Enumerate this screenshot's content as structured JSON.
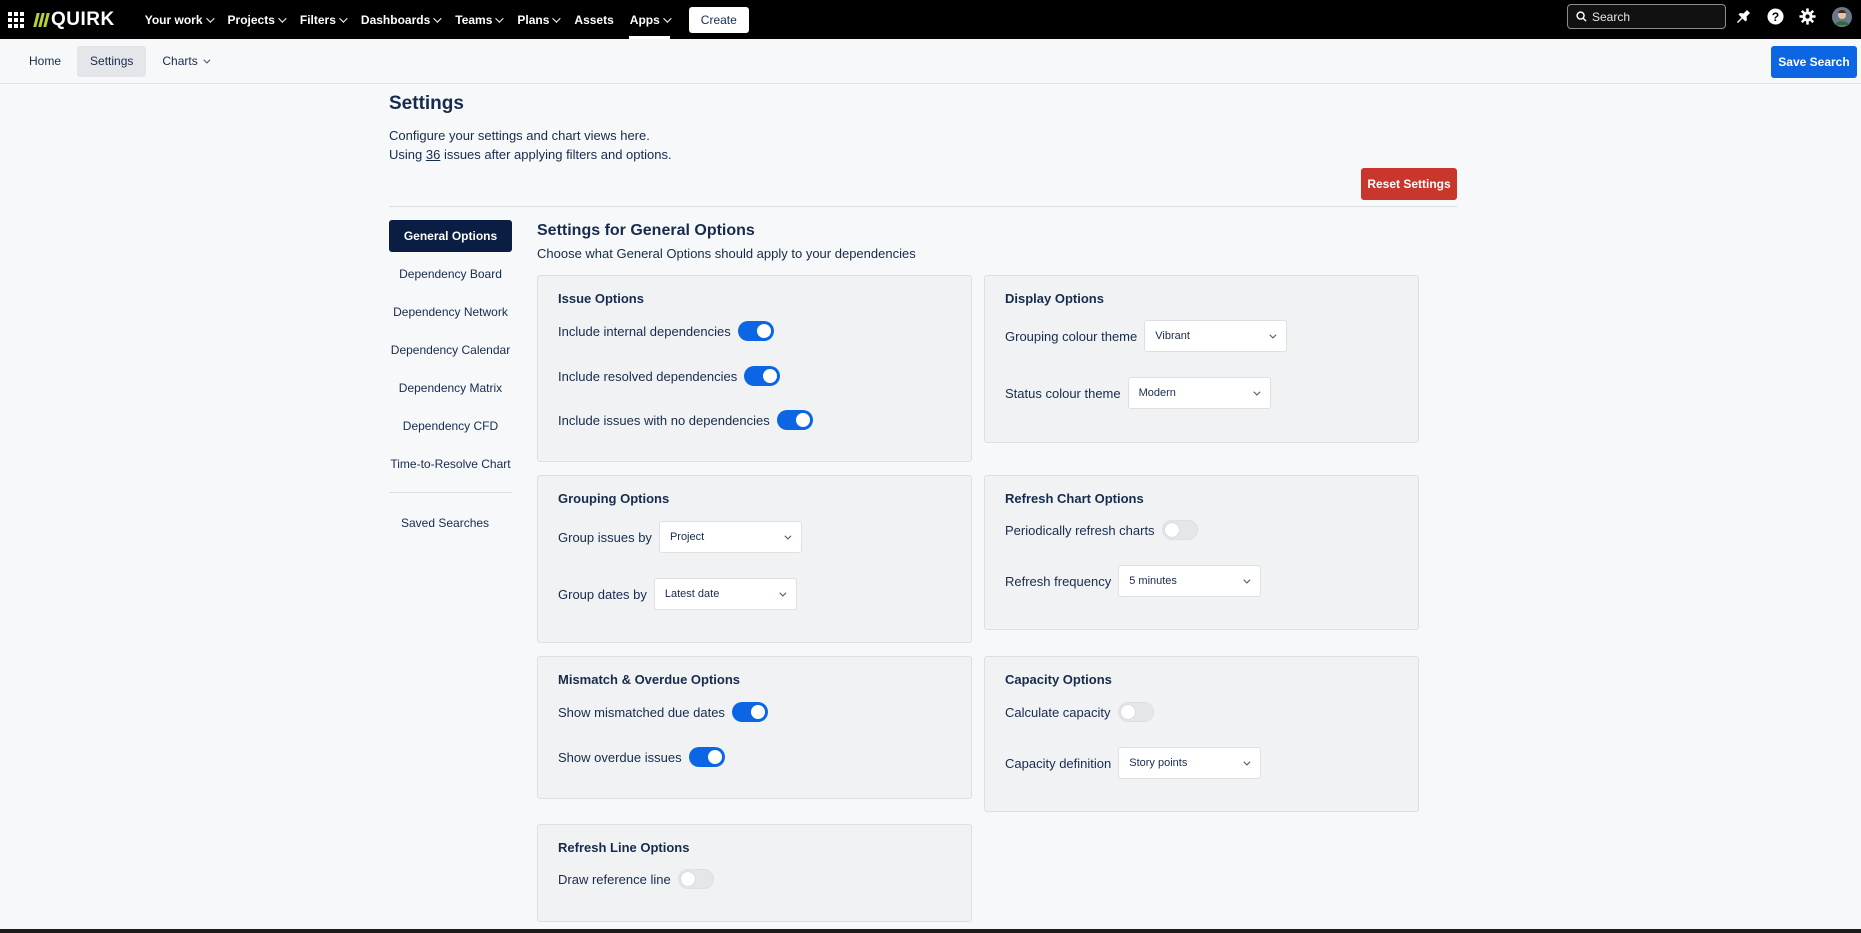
{
  "topnav": {
    "logo": "QUIRK",
    "items": [
      {
        "label": "Your work",
        "dropdown": true
      },
      {
        "label": "Projects",
        "dropdown": true
      },
      {
        "label": "Filters",
        "dropdown": true
      },
      {
        "label": "Dashboards",
        "dropdown": true
      },
      {
        "label": "Teams",
        "dropdown": true
      },
      {
        "label": "Plans",
        "dropdown": true
      },
      {
        "label": "Assets",
        "dropdown": false
      },
      {
        "label": "Apps",
        "dropdown": true,
        "active": true
      }
    ],
    "create_label": "Create",
    "search_placeholder": "Search",
    "icons": [
      "notifications-icon",
      "help-icon",
      "settings-gear-icon",
      "user-avatar"
    ]
  },
  "subbar": {
    "tabs": [
      {
        "label": "Home",
        "active": false,
        "dropdown": false
      },
      {
        "label": "Settings",
        "active": true,
        "dropdown": false
      },
      {
        "label": "Charts",
        "active": false,
        "dropdown": true
      }
    ],
    "save_search_label": "Save Search"
  },
  "page": {
    "title": "Settings",
    "desc_line1": "Configure your settings and chart views here.",
    "desc_line2_prefix": "Using ",
    "issue_count": "36",
    "desc_line2_suffix": " issues after applying filters and options.",
    "reset_label": "Reset Settings"
  },
  "side_menu": {
    "items": [
      {
        "label": "General Options",
        "active": true
      },
      {
        "label": "Dependency Board",
        "active": false
      },
      {
        "label": "Dependency Network",
        "active": false
      },
      {
        "label": "Dependency Calendar",
        "active": false
      },
      {
        "label": "Dependency Matrix",
        "active": false
      },
      {
        "label": "Dependency CFD",
        "active": false
      },
      {
        "label": "Time-to-Resolve Chart",
        "active": false
      }
    ],
    "saved_searches": "Saved Searches"
  },
  "content": {
    "title": "Settings for General Options",
    "desc": "Choose what General Options should apply to your dependencies"
  },
  "cards": {
    "issue": {
      "title": "Issue Options",
      "internal": {
        "label": "Include internal dependencies",
        "on": true
      },
      "resolved": {
        "label": "Include resolved dependencies",
        "on": true
      },
      "nodeps": {
        "label": "Include issues with no dependencies",
        "on": true
      }
    },
    "display": {
      "title": "Display Options",
      "grouping_colour": {
        "label": "Grouping colour theme",
        "value": "Vibrant"
      },
      "status_colour": {
        "label": "Status colour theme",
        "value": "Modern"
      }
    },
    "grouping": {
      "title": "Grouping Options",
      "group_issues": {
        "label": "Group issues by",
        "value": "Project"
      },
      "group_dates": {
        "label": "Group dates by",
        "value": "Latest date"
      }
    },
    "refresh_chart": {
      "title": "Refresh Chart Options",
      "periodic": {
        "label": "Periodically refresh charts",
        "on": false
      },
      "frequency": {
        "label": "Refresh frequency",
        "value": "5 minutes"
      }
    },
    "mismatch": {
      "title": "Mismatch & Overdue Options",
      "mismatched": {
        "label": "Show mismatched due dates",
        "on": true
      },
      "overdue": {
        "label": "Show overdue issues",
        "on": true
      }
    },
    "capacity": {
      "title": "Capacity Options",
      "calculate": {
        "label": "Calculate capacity",
        "on": false
      },
      "definition": {
        "label": "Capacity definition",
        "value": "Story points"
      }
    },
    "refresh_line": {
      "title": "Refresh Line Options",
      "reference": {
        "label": "Draw reference line",
        "on": false
      }
    }
  },
  "colors": {
    "accent": "#0c66e4",
    "danger": "#c9372c",
    "nav_bg": "#000000",
    "active_menu": "#091e42",
    "logo_green": "#b5d335"
  }
}
